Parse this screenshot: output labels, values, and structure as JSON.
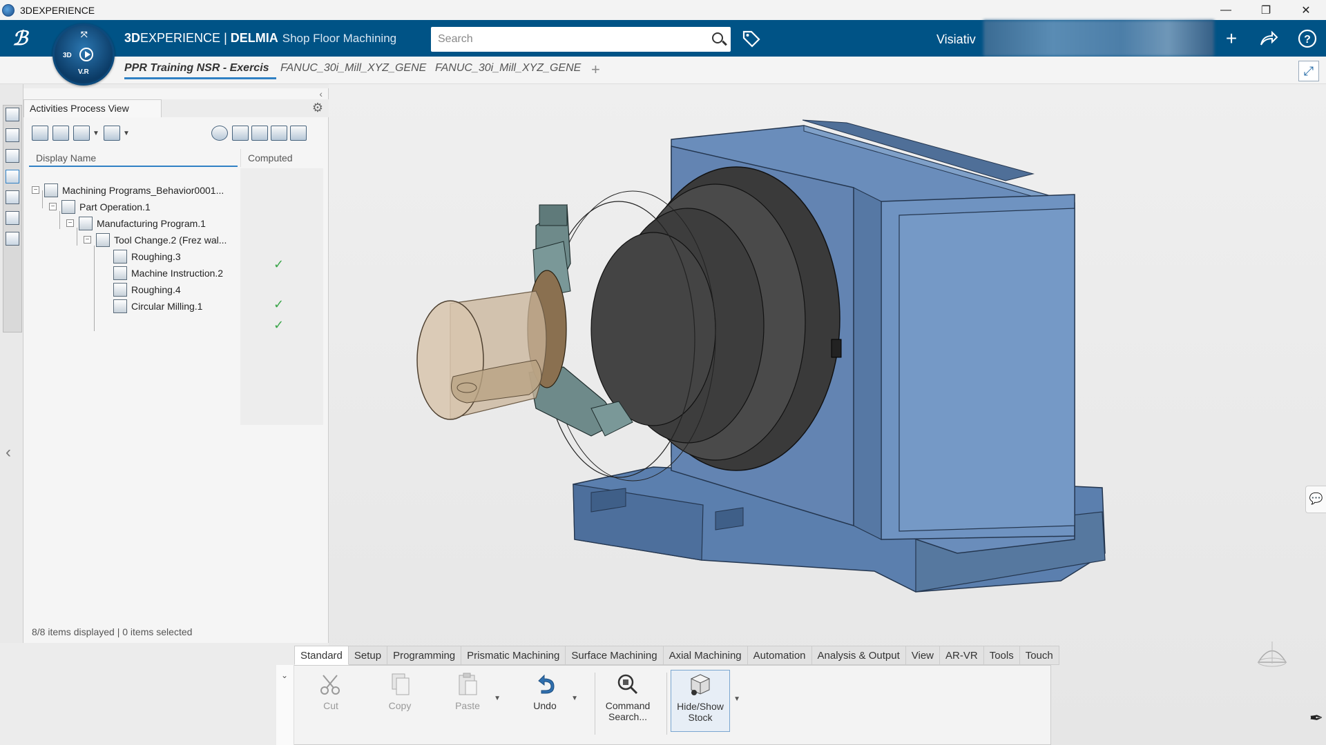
{
  "window": {
    "title": "3DEXPERIENCE",
    "controls": [
      "—",
      "❐",
      "✕"
    ]
  },
  "topbar": {
    "brand_bold": "3D",
    "brand_light": "EXPERIENCE",
    "separator": " | ",
    "brand_product": "DELMIA",
    "app_name": "Shop Floor Machining",
    "search_placeholder": "Search",
    "user_name": "Visiativ",
    "compass_labels": {
      "left": "3D",
      "bottom": "V.R"
    }
  },
  "doc_tabs": [
    {
      "label": "PPR Training NSR - Exercis",
      "active": true
    },
    {
      "label": "FANUC_30i_Mill_XYZ_GENE",
      "active": false
    },
    {
      "label": "FANUC_30i_Mill_XYZ_GENE",
      "active": false
    }
  ],
  "tree_panel": {
    "title": "Activities Process View",
    "columns": [
      "Display Name",
      "Computed"
    ],
    "rows": [
      {
        "label": "Machining Programs_Behavior0001...",
        "level": 0,
        "expand": "−",
        "computed": false
      },
      {
        "label": "Part Operation.1",
        "level": 1,
        "expand": "−",
        "computed": false
      },
      {
        "label": "Manufacturing Program.1",
        "level": 2,
        "expand": "−",
        "computed": false
      },
      {
        "label": "Tool Change.2 (Frez wal...",
        "level": 3,
        "expand": "−",
        "computed": false
      },
      {
        "label": "Roughing.3",
        "level": 4,
        "expand": "",
        "computed": true
      },
      {
        "label": "Machine Instruction.2",
        "level": 4,
        "expand": "",
        "computed": false
      },
      {
        "label": "Roughing.4",
        "level": 4,
        "expand": "",
        "computed": true
      },
      {
        "label": "Circular Milling.1",
        "level": 4,
        "expand": "",
        "computed": true
      }
    ],
    "status": "8/8 items displayed | 0 items selected"
  },
  "action_bar": {
    "tabs": [
      "Standard",
      "Setup",
      "Programming",
      "Prismatic Machining",
      "Surface Machining",
      "Axial Machining",
      "Automation",
      "Analysis & Output",
      "View",
      "AR-VR",
      "Tools",
      "Touch"
    ],
    "commands": {
      "cut": "Cut",
      "copy": "Copy",
      "paste": "Paste",
      "undo": "Undo",
      "command_search": "Command Search...",
      "hide_show_stock": "Hide/Show Stock"
    }
  },
  "colors": {
    "topbar": "#005386",
    "accent": "#2f80c4",
    "model_blue": "#5b7fae",
    "model_dark": "#3a3a3a",
    "stock": "#c9b49a",
    "check_green": "#3aa64a"
  }
}
